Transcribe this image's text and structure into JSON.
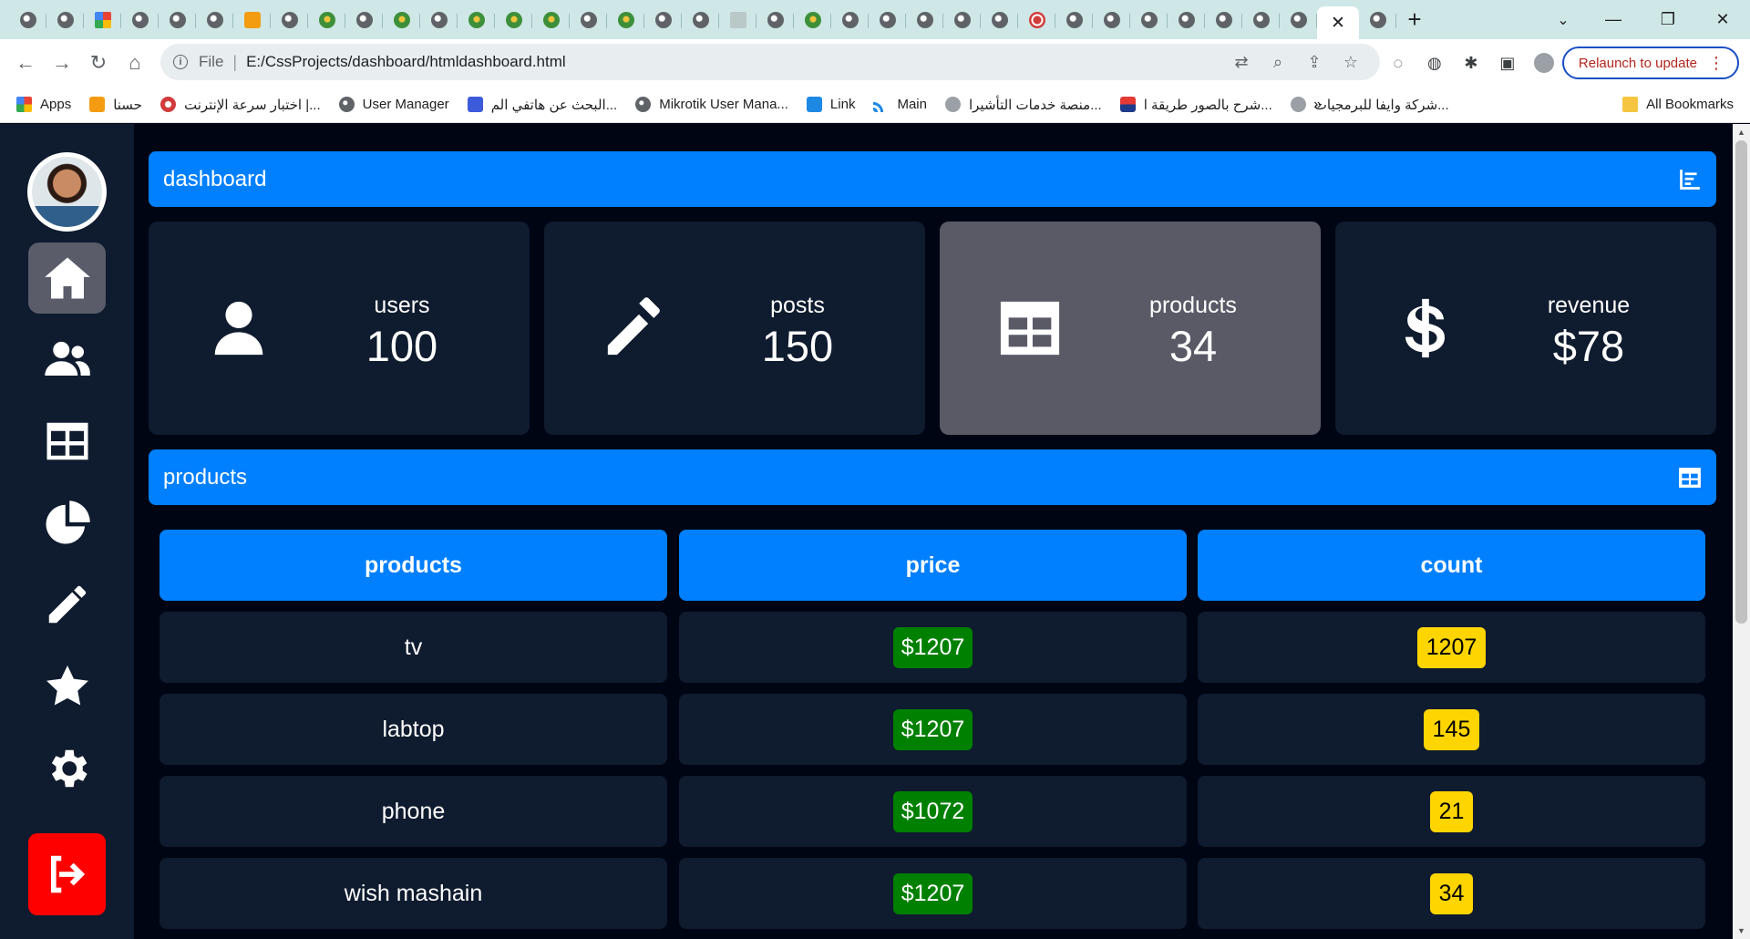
{
  "browser": {
    "url_scheme": "File",
    "url": "E:/CssProjects/dashboard/htmldashboard.html",
    "relaunch_label": "Relaunch to update",
    "bookmarks": [
      {
        "label": "Apps",
        "icon": "apps"
      },
      {
        "label": "حسنا",
        "icon": "orange"
      },
      {
        "label": "اختبار سرعة الإنترنت |...",
        "icon": "red"
      },
      {
        "label": "User Manager",
        "icon": "globe"
      },
      {
        "label": "البحث عن هاتفي الم...",
        "icon": "blue"
      },
      {
        "label": "Mikrotik User Mana...",
        "icon": "globe"
      },
      {
        "label": "Link",
        "icon": "sky"
      },
      {
        "label": "Main",
        "icon": "rss"
      },
      {
        "label": "منصة خدمات التأشيرا...",
        "icon": "grey"
      },
      {
        "label": "شرح بالصور طريقة ا...",
        "icon": "flagc"
      },
      {
        "label": "شركة وايفا للبرمجيات...",
        "icon": "grey"
      }
    ],
    "all_bookmarks_label": "All Bookmarks"
  },
  "dashboard": {
    "header_title": "dashboard",
    "cards": [
      {
        "label": "users",
        "value": "100",
        "icon": "user-icon"
      },
      {
        "label": "posts",
        "value": "150",
        "icon": "pencil-icon"
      },
      {
        "label": "products",
        "value": "34",
        "icon": "table-icon"
      },
      {
        "label": "revenue",
        "value": "$78",
        "icon": "dollar-icon"
      }
    ],
    "products_title": "products",
    "table": {
      "headers": [
        "products",
        "price",
        "count"
      ],
      "rows": [
        {
          "product": "tv",
          "price": "$1207",
          "count": "1207"
        },
        {
          "product": "labtop",
          "price": "$1207",
          "count": "145"
        },
        {
          "product": "phone",
          "price": "$1072",
          "count": "21"
        },
        {
          "product": "wish mashain",
          "price": "$1207",
          "count": "34"
        }
      ]
    }
  },
  "colors": {
    "accent": "#0080ff",
    "panel": "#0f1b2e",
    "highlight": "#595a66",
    "logout": "#ff0000",
    "price_badge": "#008000",
    "count_badge": "#ffd500"
  }
}
